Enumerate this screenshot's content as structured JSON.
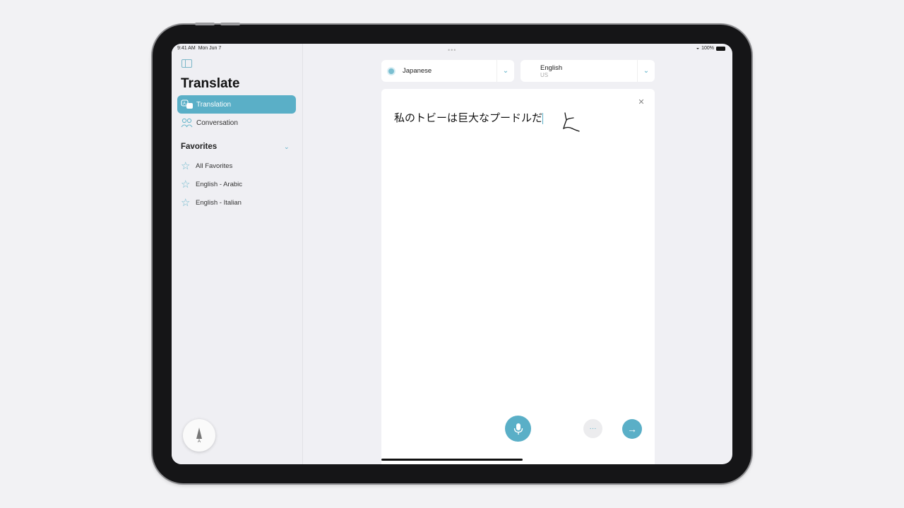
{
  "status_bar": {
    "time": "9:41 AM",
    "date": "Mon Jun 7",
    "battery": "100%"
  },
  "sidebar": {
    "app_title": "Translate",
    "nav": [
      {
        "label": "Translation",
        "icon": "translation-icon",
        "active": true
      },
      {
        "label": "Conversation",
        "icon": "conversation-icon",
        "active": false
      }
    ],
    "favorites_title": "Favorites",
    "favorites": [
      {
        "label": "All Favorites",
        "icon": "star-icon"
      },
      {
        "label": "English - Arabic",
        "icon": "star-icon"
      },
      {
        "label": "English - Italian",
        "icon": "star-icon"
      }
    ]
  },
  "main": {
    "source_language": "Japanese",
    "target_language": "English",
    "target_language_region": "US",
    "source_text": "私のトビーは巨大なプードルだ",
    "actions": {
      "mic": "microphone-icon",
      "more": "···",
      "go": "→"
    },
    "accent_color": "#5aafc7"
  },
  "pencil": {
    "label": "A"
  }
}
